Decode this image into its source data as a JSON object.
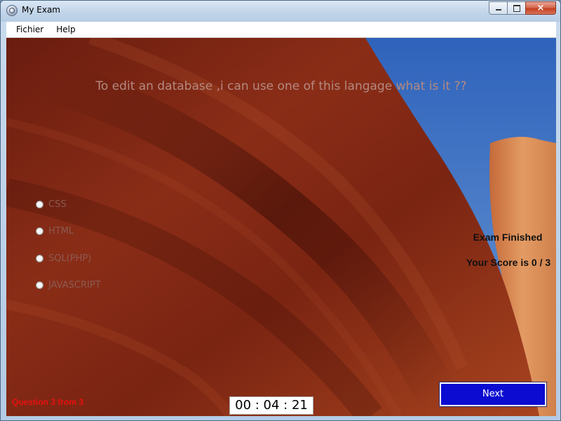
{
  "window": {
    "title": "My Exam",
    "controls": {
      "close_glyph": "×"
    }
  },
  "menu": {
    "items": [
      {
        "label": "Fichier"
      },
      {
        "label": "Help"
      }
    ]
  },
  "exam": {
    "question": "To edit an database ,i can use one of this langage what is it ??",
    "options": [
      {
        "label": "CSS"
      },
      {
        "label": "HTML"
      },
      {
        "label": "SQL(PHP)"
      },
      {
        "label": "JAVASCRIPT"
      }
    ],
    "result_title": "Exam Finished",
    "result_score": "Your Score is 0 / 3",
    "question_counter": "Question 3 from 3",
    "timer": "00 : 04 : 21",
    "next_label": "Next"
  },
  "colors": {
    "accent_button": "#0b0bd1",
    "counter_text": "#e81010",
    "rock": "#7a2414",
    "sky": "#3a6ec2"
  },
  "icons": {
    "app": "app-icon",
    "minimize": "minimize-icon",
    "maximize": "maximize-icon",
    "close": "close-icon"
  }
}
